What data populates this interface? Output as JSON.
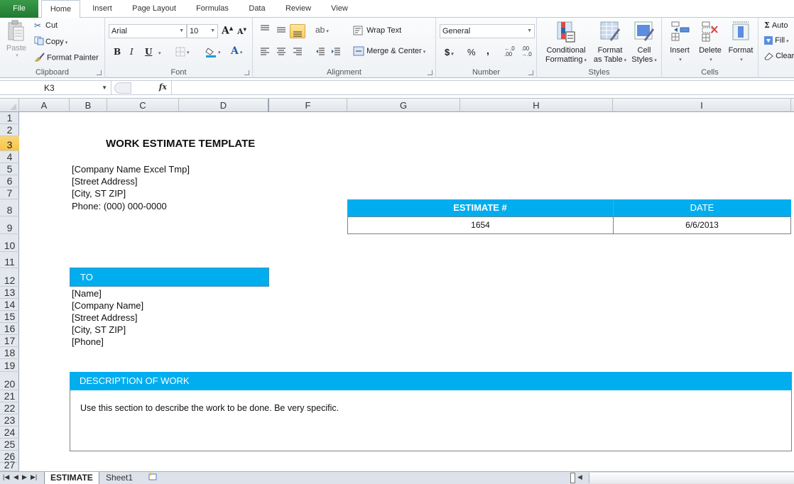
{
  "ribbon_tabs": {
    "file": "File",
    "home": "Home",
    "insert": "Insert",
    "page_layout": "Page Layout",
    "formulas": "Formulas",
    "data": "Data",
    "review": "Review",
    "view": "View"
  },
  "clipboard": {
    "paste": "Paste",
    "cut": "Cut",
    "copy": "Copy",
    "format_painter": "Format Painter",
    "label": "Clipboard"
  },
  "font": {
    "name": "Arial",
    "size": "10",
    "label": "Font",
    "bold": "B",
    "italic": "I",
    "underline": "U",
    "font_color_glyph": "A"
  },
  "alignment": {
    "wrap_text": "Wrap Text",
    "merge_center": "Merge & Center",
    "label": "Alignment"
  },
  "number": {
    "format": "General",
    "currency": "$",
    "percent": "%",
    "comma": ",",
    "label": "Number"
  },
  "styles": {
    "conditional_formatting_1": "Conditional",
    "conditional_formatting_2": "Formatting",
    "format_as_table_1": "Format",
    "format_as_table_2": "as Table",
    "cell_styles_1": "Cell",
    "cell_styles_2": "Styles",
    "label": "Styles"
  },
  "cells": {
    "insert": "Insert",
    "delete": "Delete",
    "format": "Format",
    "label": "Cells"
  },
  "editing": {
    "autosum": "Auto",
    "fill": "Fill",
    "clear": "Clear"
  },
  "formula_bar": {
    "name_box": "K3",
    "fx": "fx",
    "formula": ""
  },
  "columns": [
    "A",
    "B",
    "C",
    "D",
    "F",
    "G",
    "H",
    "I"
  ],
  "rows": [
    "1",
    "2",
    "3",
    "4",
    "5",
    "6",
    "7",
    "8",
    "9",
    "10",
    "11",
    "12",
    "13",
    "14",
    "15",
    "16",
    "17",
    "18",
    "19",
    "20",
    "21",
    "22",
    "23",
    "24",
    "25",
    "26",
    "27"
  ],
  "selected_row": "3",
  "document": {
    "title": "WORK ESTIMATE TEMPLATE",
    "company": {
      "name": "[Company Name Excel Tmp]",
      "street": "[Street Address]",
      "city": "[City, ST  ZIP]",
      "phone": "Phone: (000) 000-0000"
    },
    "estimate": {
      "estimate_header": "ESTIMATE #",
      "date_header": "DATE",
      "estimate_number": "1654",
      "date": "6/6/2013"
    },
    "to": {
      "header": "TO",
      "name": "[Name]",
      "company": "[Company Name]",
      "street": "[Street Address]",
      "city": "[City, ST  ZIP]",
      "phone": "[Phone]"
    },
    "description": {
      "header": "DESCRIPTION OF WORK",
      "text": "Use this section to describe the work to be done. Be very specific."
    }
  },
  "sheet_tabs": {
    "active": "ESTIMATE",
    "other": "Sheet1"
  },
  "colors": {
    "accent": "#00adef",
    "file_tab": "#2a8a3d",
    "selected_row": "#f7c545"
  }
}
